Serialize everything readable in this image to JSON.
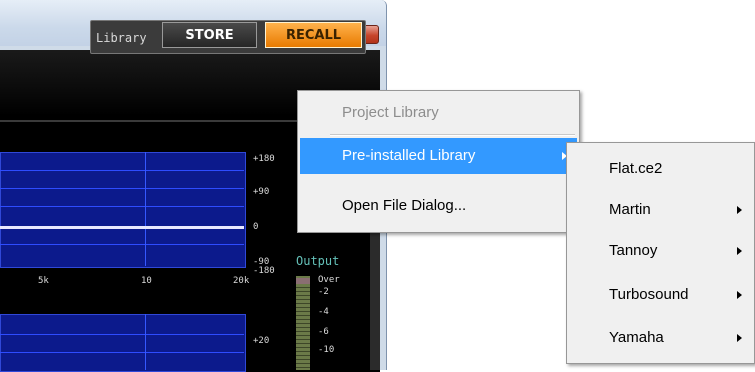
{
  "window": {
    "minimize_icon": "minimize-icon",
    "maximize_icon": "maximize-icon",
    "close_icon": "close-icon",
    "close_glyph": "✕"
  },
  "library": {
    "label": "Library",
    "store_label": "STORE",
    "recall_label": "RECALL"
  },
  "graph": {
    "right_ticks": [
      "+180",
      "+90",
      "0",
      "-90",
      "-180"
    ],
    "x_ticks": [
      "5k",
      "10",
      "20k"
    ],
    "right_ticks_lower": [
      "+20"
    ]
  },
  "output": {
    "label": "Output",
    "scale": [
      "Over",
      "-2",
      "-4",
      "-6",
      "-10"
    ]
  },
  "context_menu": {
    "items": [
      {
        "label": "Project Library",
        "disabled": true
      },
      {
        "label": "Pre-installed Library",
        "submenu": true,
        "active": true
      },
      {
        "label": "Open File Dialog..."
      }
    ]
  },
  "submenu": {
    "items": [
      {
        "label": "Flat.ce2",
        "submenu": false
      },
      {
        "label": "Martin",
        "submenu": true
      },
      {
        "label": "Tannoy",
        "submenu": true
      },
      {
        "label": "Turbosound",
        "submenu": true
      },
      {
        "label": "Yamaha",
        "submenu": true
      }
    ]
  },
  "colors": {
    "accent": "#3399ff",
    "recall_orange": "#e87a00",
    "plot_blue": "#0c1a8c"
  }
}
